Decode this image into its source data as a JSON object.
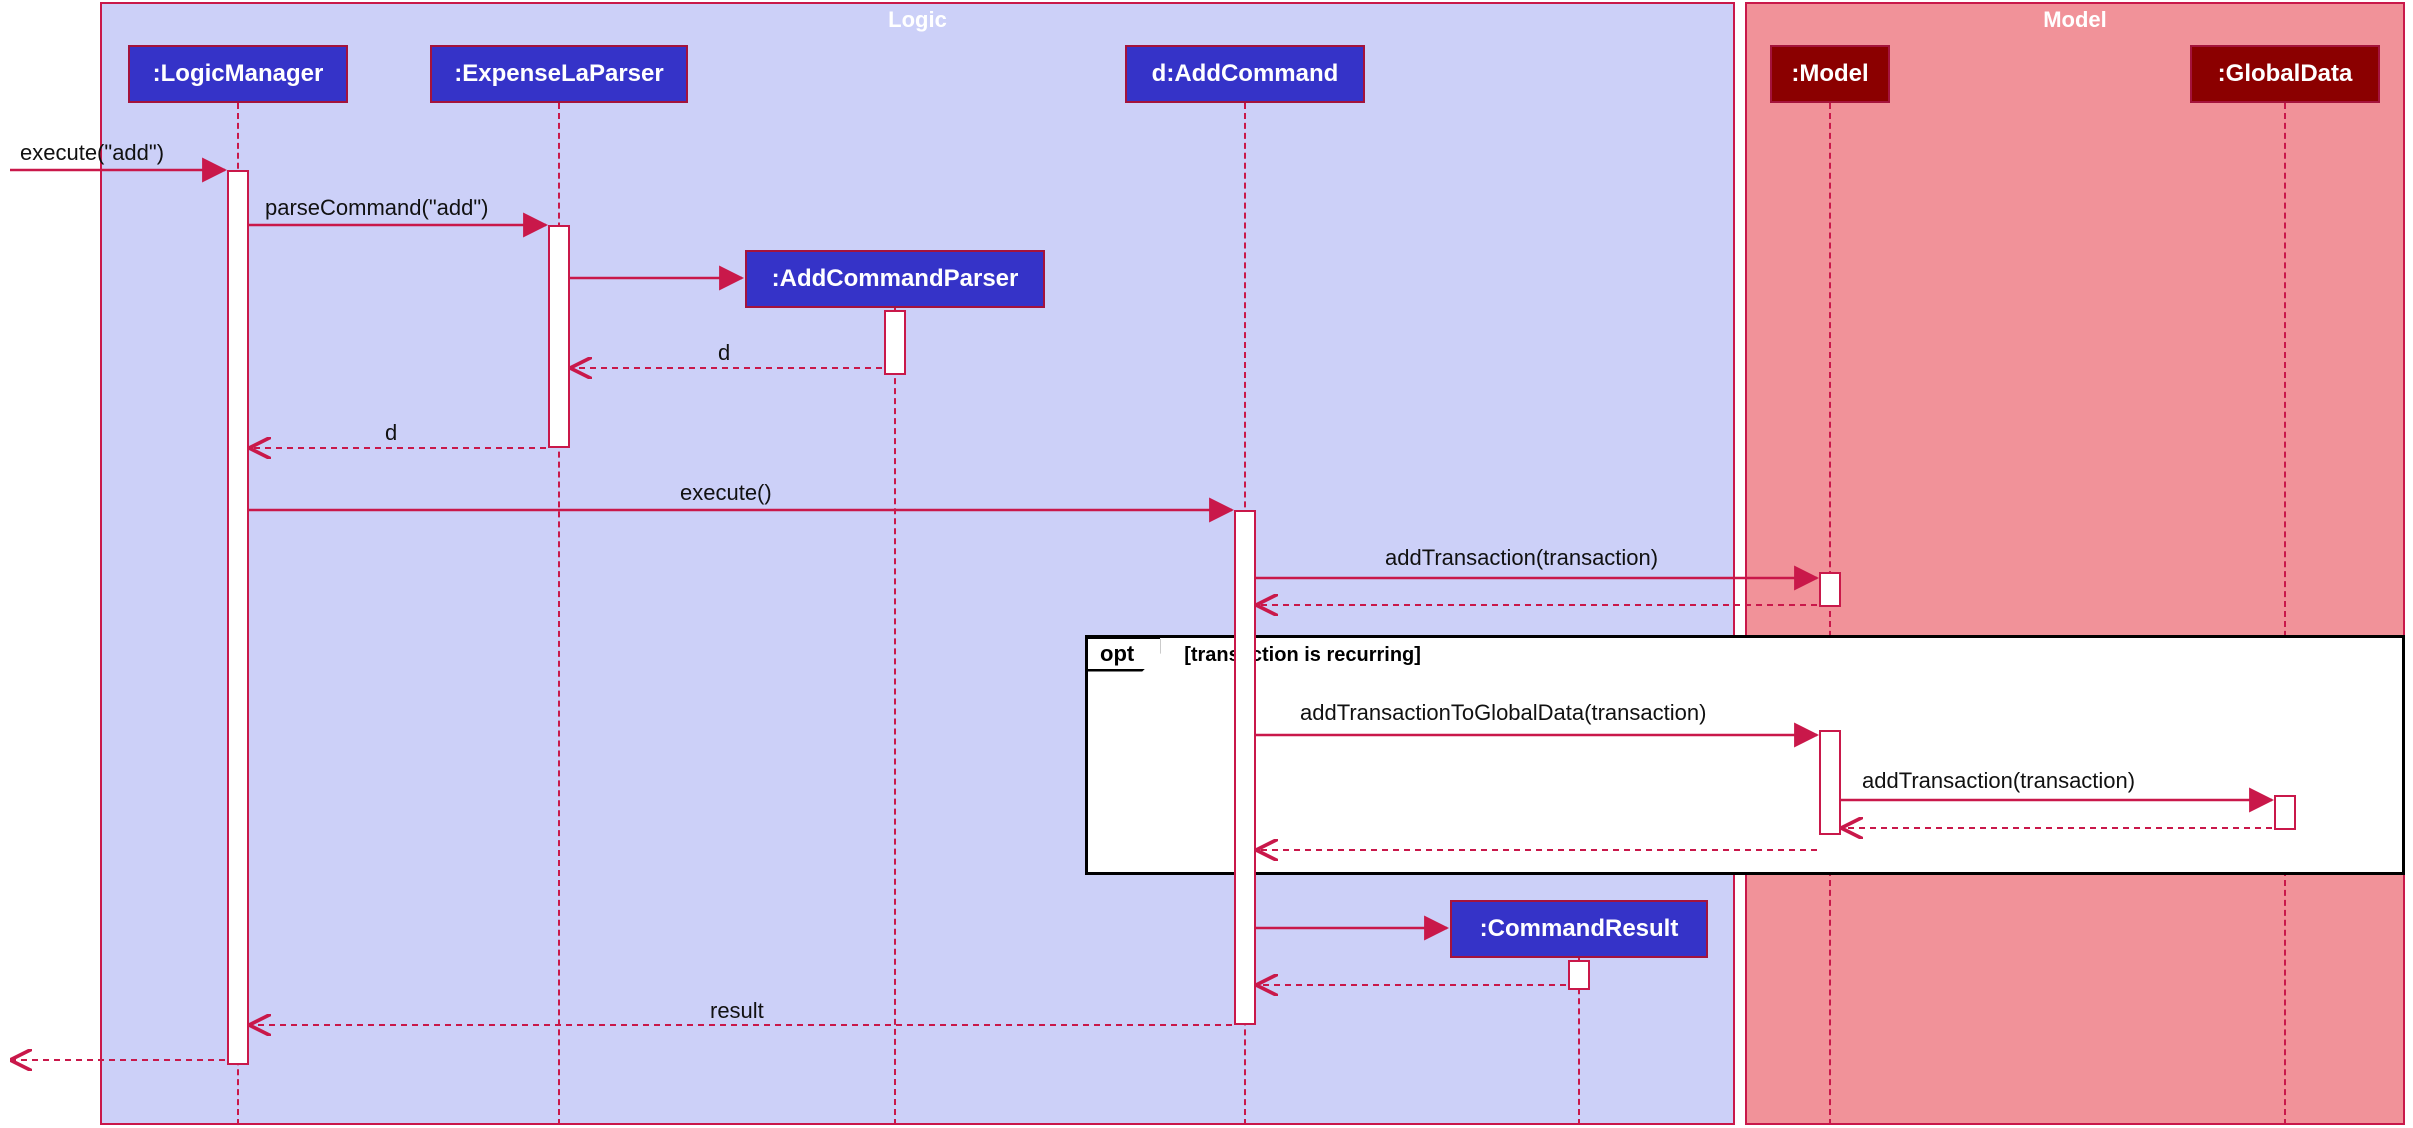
{
  "frames": {
    "logic": {
      "title": "Logic"
    },
    "model": {
      "title": "Model"
    }
  },
  "lifelines": {
    "logicManager": {
      "label": ":LogicManager"
    },
    "expenseLaParser": {
      "label": ":ExpenseLaParser"
    },
    "addCommandParser": {
      "label": ":AddCommandParser"
    },
    "addCommand": {
      "label": "d:AddCommand"
    },
    "commandResult": {
      "label": ":CommandResult"
    },
    "model": {
      "label": ":Model"
    },
    "globalData": {
      "label": ":GlobalData"
    }
  },
  "messages": {
    "executeAdd": "execute(\"add\")",
    "parseCommand": "parseCommand(\"add\")",
    "returnD1": "d",
    "returnD2": "d",
    "executeCall": "execute()",
    "addTransaction": "addTransaction(transaction)",
    "addToGlobal": "addTransactionToGlobalData(transaction)",
    "addTransaction2": "addTransaction(transaction)",
    "result": "result"
  },
  "optFrame": {
    "label": "opt",
    "guard": "[transaction is recurring]"
  }
}
